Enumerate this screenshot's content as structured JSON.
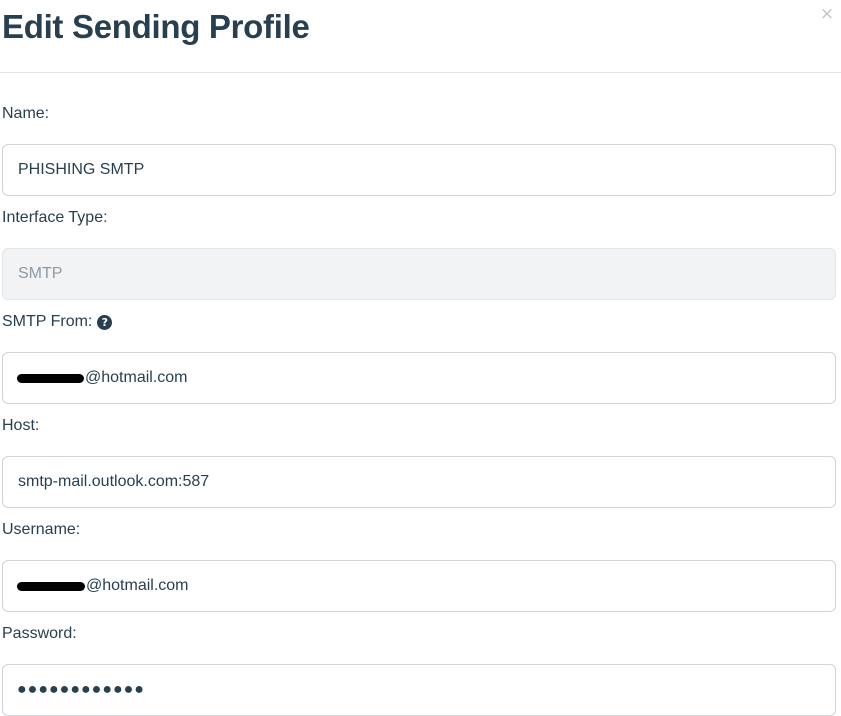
{
  "modal": {
    "title": "Edit Sending Profile",
    "close_glyph": "×"
  },
  "form": {
    "name": {
      "label": "Name:",
      "value": "PHISHING SMTP"
    },
    "interface_type": {
      "label": "Interface Type:",
      "value": "SMTP"
    },
    "smtp_from": {
      "label": "SMTP From:",
      "help_icon": "question-circle-icon",
      "value_suffix": "@hotmail.com"
    },
    "host": {
      "label": "Host:",
      "value": "smtp-mail.outlook.com:587"
    },
    "username": {
      "label": "Username:",
      "value_suffix": "@hotmail.com"
    },
    "password": {
      "label": "Password:",
      "value": "●●●●●●●●●●●●"
    }
  },
  "colors": {
    "text": "#283f50",
    "border": "#d0d4d8",
    "disabled_bg": "#f1f3f4",
    "disabled_text": "#8f9aa3"
  }
}
